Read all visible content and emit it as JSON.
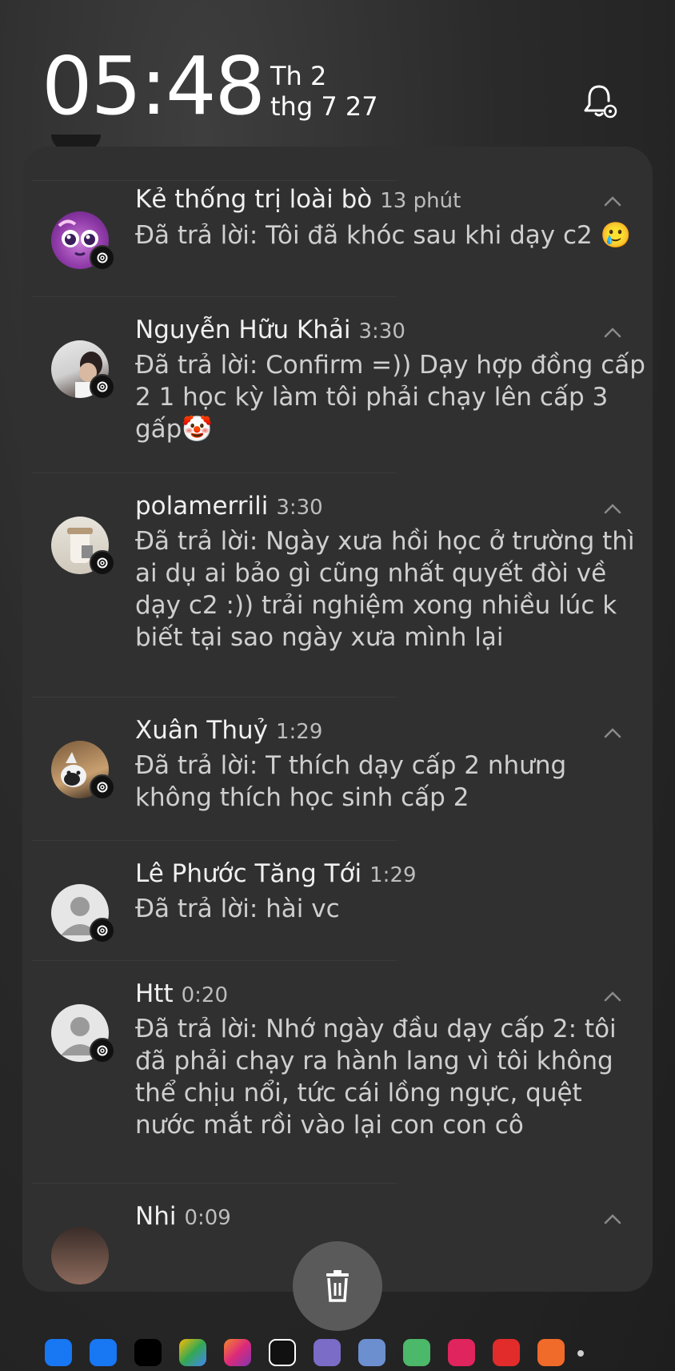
{
  "status": {
    "clock": "05:48",
    "day": "Th 2",
    "date": "thg 7 27"
  },
  "notifications": [
    {
      "name": "Kẻ thống trị loài bò",
      "time": "13 phút",
      "text": "Đã trả lời: Tôi đã khóc sau khi dạy c2 🥲",
      "avatar": "avatar-cartoon"
    },
    {
      "name": "Nguyễn Hữu Khải",
      "time": "3:30",
      "text": "Đã trả lời: Confirm =)) Dạy hợp đồng cấp 2 1 học kỳ làm tôi phải chạy lên cấp 3 gấp🤡",
      "avatar": "avatar-photo"
    },
    {
      "name": "polamerrili",
      "time": "3:30",
      "text": "Đã trả lời: Ngày xưa hồi học ở trường thì ai dụ ai bảo gì cũng nhất quyết đòi về dạy c2 :)) trải nghiệm xong nhiều lúc k biết tại sao ngày xưa mình lại",
      "avatar": "avatar-photo"
    },
    {
      "name": "Xuân Thuỷ",
      "time": "1:29",
      "text": "Đã trả lời: T thích dạy cấp 2 nhưng không thích học sinh cấp 2",
      "avatar": "avatar-cat"
    },
    {
      "name": "Lê Phước Tăng Tới",
      "time": "1:29",
      "text": "Đã trả lời: hài vc",
      "avatar": "avatar-default"
    },
    {
      "name": "Htt",
      "time": "0:20",
      "text": "Đã trả lời: Nhớ ngày đầu dạy cấp 2: tôi đã phải chạy ra hành lang vì tôi không thể chịu nổi, tức cái lồng ngực, quệt nước mắt rồi vào lại con con cô",
      "avatar": "avatar-default"
    },
    {
      "name": "Nhi",
      "time": "0:09",
      "text": "",
      "avatar": "avatar-photo"
    }
  ],
  "dock_apps": [
    "messenger-icon",
    "facebook-icon",
    "threads-icon",
    "photos-icon",
    "instagram-icon",
    "capcut-icon",
    "game-icon",
    "game-icon",
    "game-icon",
    "game-icon",
    "reddit-icon",
    "game-icon"
  ],
  "colors": {
    "panel": "#303030",
    "background": "#2a2a2a",
    "text": "#e8e8e8"
  }
}
